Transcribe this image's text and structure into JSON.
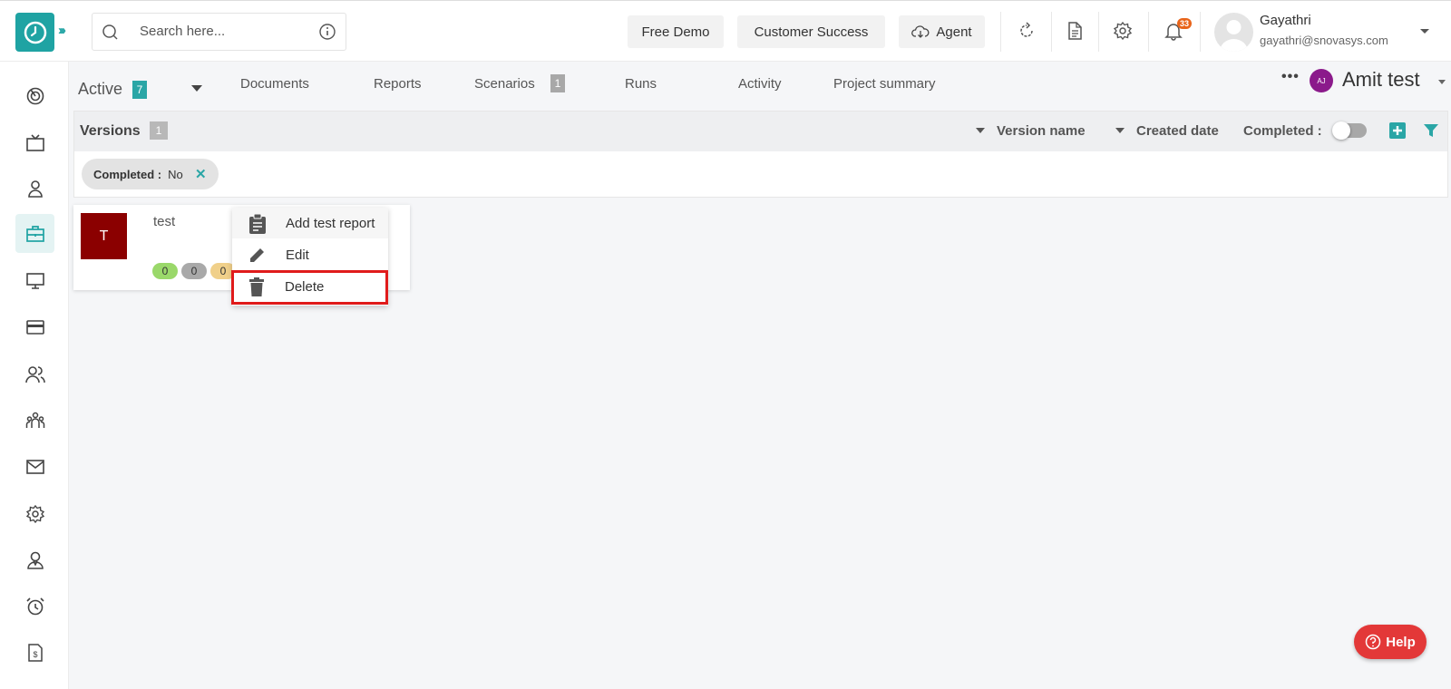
{
  "search": {
    "placeholder": "Search here..."
  },
  "topbar": {
    "free_demo": "Free Demo",
    "customer_success": "Customer Success",
    "agent": "Agent",
    "notification_count": "33",
    "user_name": "Gayathri",
    "user_email": "gayathri@snovasys.com"
  },
  "subnav": {
    "active_label": "Active",
    "active_count": "7",
    "tabs": [
      {
        "label": "Documents"
      },
      {
        "label": "Reports"
      },
      {
        "label": "Scenarios",
        "count": "1"
      },
      {
        "label": "Runs"
      },
      {
        "label": "Activity"
      },
      {
        "label": "Project summary"
      }
    ],
    "project_initials": "AJ",
    "project_name": "Amit test"
  },
  "versions": {
    "title": "Versions",
    "count": "1",
    "sort_version_name": "Version name",
    "sort_created_date": "Created date",
    "completed_label": "Completed :",
    "completed_toggle": false,
    "filter_chip": {
      "label": "Completed :",
      "value": "No"
    }
  },
  "card": {
    "thumb_letter": "T",
    "title": "test",
    "pills": [
      "0",
      "0",
      "0"
    ]
  },
  "menu": {
    "items": [
      {
        "label": "Add test report"
      },
      {
        "label": "Edit"
      },
      {
        "label": "Delete"
      }
    ]
  },
  "help": {
    "label": "Help"
  },
  "colors": {
    "accent": "#1fa3a3",
    "danger": "#e01b1b",
    "help": "#e33838"
  }
}
